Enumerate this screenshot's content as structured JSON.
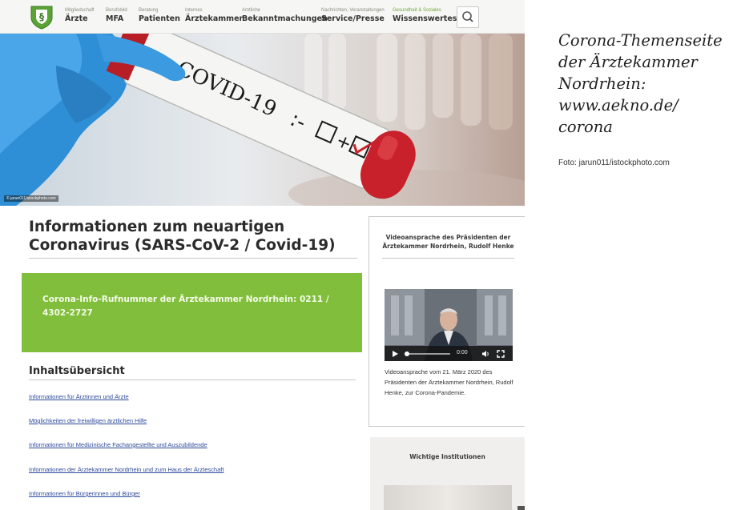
{
  "nav": {
    "search_icon": "magnifier",
    "items": [
      {
        "small": "Mitgliedschaft",
        "big": "Ärzte"
      },
      {
        "small": "Berufsbild",
        "big": "MFA"
      },
      {
        "small": "Beratung",
        "big": "Patienten"
      },
      {
        "small": "Internes",
        "big": "Ärztekammer"
      },
      {
        "small": "Amtliche",
        "big": "Bekanntmachungen"
      },
      {
        "small": "Nachrichten, Veranstaltungen",
        "big": "Service/Presse"
      },
      {
        "small": "Gesundheit & Soziales",
        "big": "Wissenswertes"
      }
    ]
  },
  "hero": {
    "tube_label": "COVID-19",
    "credit": "© jarun011/istockphoto.com"
  },
  "main": {
    "title": "Informationen zum neuartigen Coronavirus (SARS-CoV-2 / Covid-19)",
    "hotline": "Corona-Info-Rufnummer der Ärztekammer Nordrhein: 0211 / 4302-2727",
    "toc_heading": "Inhaltsübersicht",
    "toc_links": [
      "Informationen für Ärztinnen und Ärzte",
      "Möglichkeiten der freiwilligen ärztlichen Hilfe",
      "Informationen für Medizinische Fachangestellte und Auszubildende",
      "Informationen der Ärztekammer Nordrhein und zum Haus der Ärzteschaft",
      "Informationen für Bürgerinnen und Bürger"
    ]
  },
  "sidebar": {
    "video_title": "Videoansprache des Präsidenten der Ärztekammer Nordrhein, Rudolf Henke",
    "video_time": "0:00",
    "video_caption": "Videoansprache vom 21. März 2020 des Präsidenten der Ärztekammer Nordrhein, Rudolf Henke, zur Corona-Pandemie.",
    "institutions_title": "Wichtige Institutionen"
  },
  "caption": {
    "lines": [
      "Corona-Themenseite",
      "der Ärztekammer",
      "Nordrhein:",
      "www.aekno.de/",
      "corona"
    ],
    "photo_credit": "Foto: jarun011/istockphoto.com"
  },
  "colors": {
    "accent_green": "#80be3c",
    "link_blue": "#2e4a9a",
    "glove_blue": "#2f8fd6",
    "cap_red": "#c8212b"
  }
}
